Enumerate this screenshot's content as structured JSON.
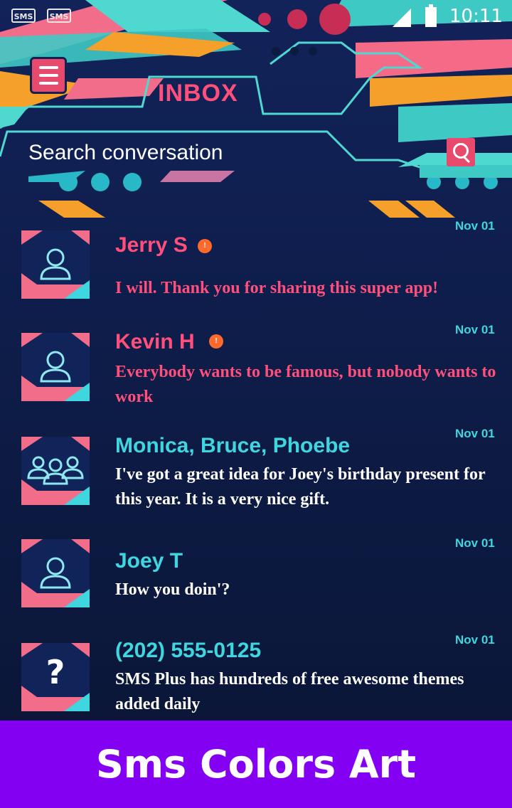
{
  "status_bar": {
    "notification_icons": [
      "SMS",
      "SMS"
    ],
    "time": "10:11"
  },
  "app_bar": {
    "title": "INBOX",
    "search_placeholder": "Search conversation"
  },
  "conversations": [
    {
      "name": "Jerry S",
      "unread": true,
      "unread_mark": "!",
      "date": "Nov 01",
      "snippet": "I will. Thank you for sharing this super app!",
      "avatar": "person-icon"
    },
    {
      "name": "Kevin H",
      "unread": true,
      "unread_mark": "!",
      "date": "Nov 01",
      "snippet": "Everybody wants to be famous, but nobody wants to work",
      "avatar": "person-icon"
    },
    {
      "name": "Monica, Bruce, Phoebe",
      "unread": false,
      "date": "Nov 01",
      "snippet": "I've got a great idea for Joey's birthday present for this year. It is a very nice gift.",
      "avatar": "group-icon"
    },
    {
      "name": "Joey T",
      "unread": false,
      "date": "Nov 01",
      "snippet": "How you doin'?",
      "avatar": "person-icon"
    },
    {
      "name": "(202) 555-0125",
      "unread": false,
      "date": "Nov 01",
      "snippet": "SMS Plus has hundreds of free awesome themes added daily",
      "avatar": "unknown-contact-icon",
      "avatar_text": "?"
    }
  ],
  "promo": {
    "label": "Sms Colors Art",
    "color": "#8400f2"
  },
  "colors": {
    "unread_accent": "#ff4f7b",
    "read_accent": "#3fd6e0",
    "background": "#0e1d4a"
  }
}
